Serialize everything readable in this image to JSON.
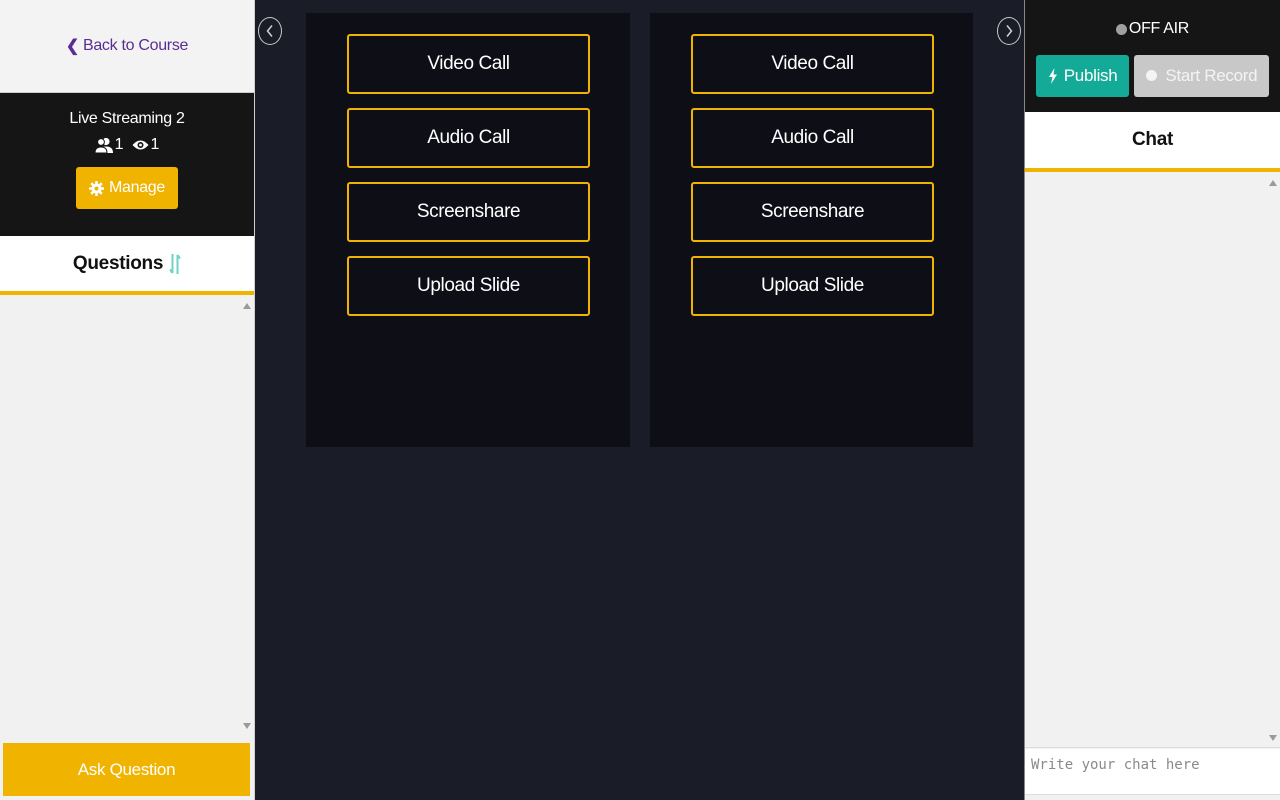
{
  "left_sidebar": {
    "back_link": {
      "label": "Back to Course",
      "icon": "chevron-left-icon"
    },
    "session": {
      "title": "Live Streaming 2",
      "participants_count": "1",
      "viewers_count": "1",
      "manage_label": "Manage"
    },
    "questions": {
      "title": "Questions",
      "sort_icon": "sort-icon",
      "items": []
    },
    "ask_question_label": "Ask Question"
  },
  "main": {
    "nav_prev_icon": "chevron-left-circle-icon",
    "nav_next_icon": "chevron-right-circle-icon",
    "panels": [
      {
        "actions": [
          "Video Call",
          "Audio Call",
          "Screenshare",
          "Upload Slide"
        ]
      },
      {
        "actions": [
          "Video Call",
          "Audio Call",
          "Screenshare",
          "Upload Slide"
        ]
      }
    ]
  },
  "right_panel": {
    "status": "OFF AIR",
    "publish_label": "Publish",
    "record_label": "Start Record",
    "chat": {
      "title": "Chat",
      "messages": [],
      "input_value": "",
      "input_placeholder": "Write your chat here"
    }
  },
  "colors": {
    "accent": "#f0b400",
    "publish": "#13ab98",
    "record_disabled": "#c8c8c8",
    "link": "#5a2d91",
    "sort_icon": "#6fd3c7",
    "main_bg": "#1a1c28",
    "panel_bg": "#0d0e16",
    "header_bg": "#151515",
    "status_dot": "#a0a0a0"
  }
}
